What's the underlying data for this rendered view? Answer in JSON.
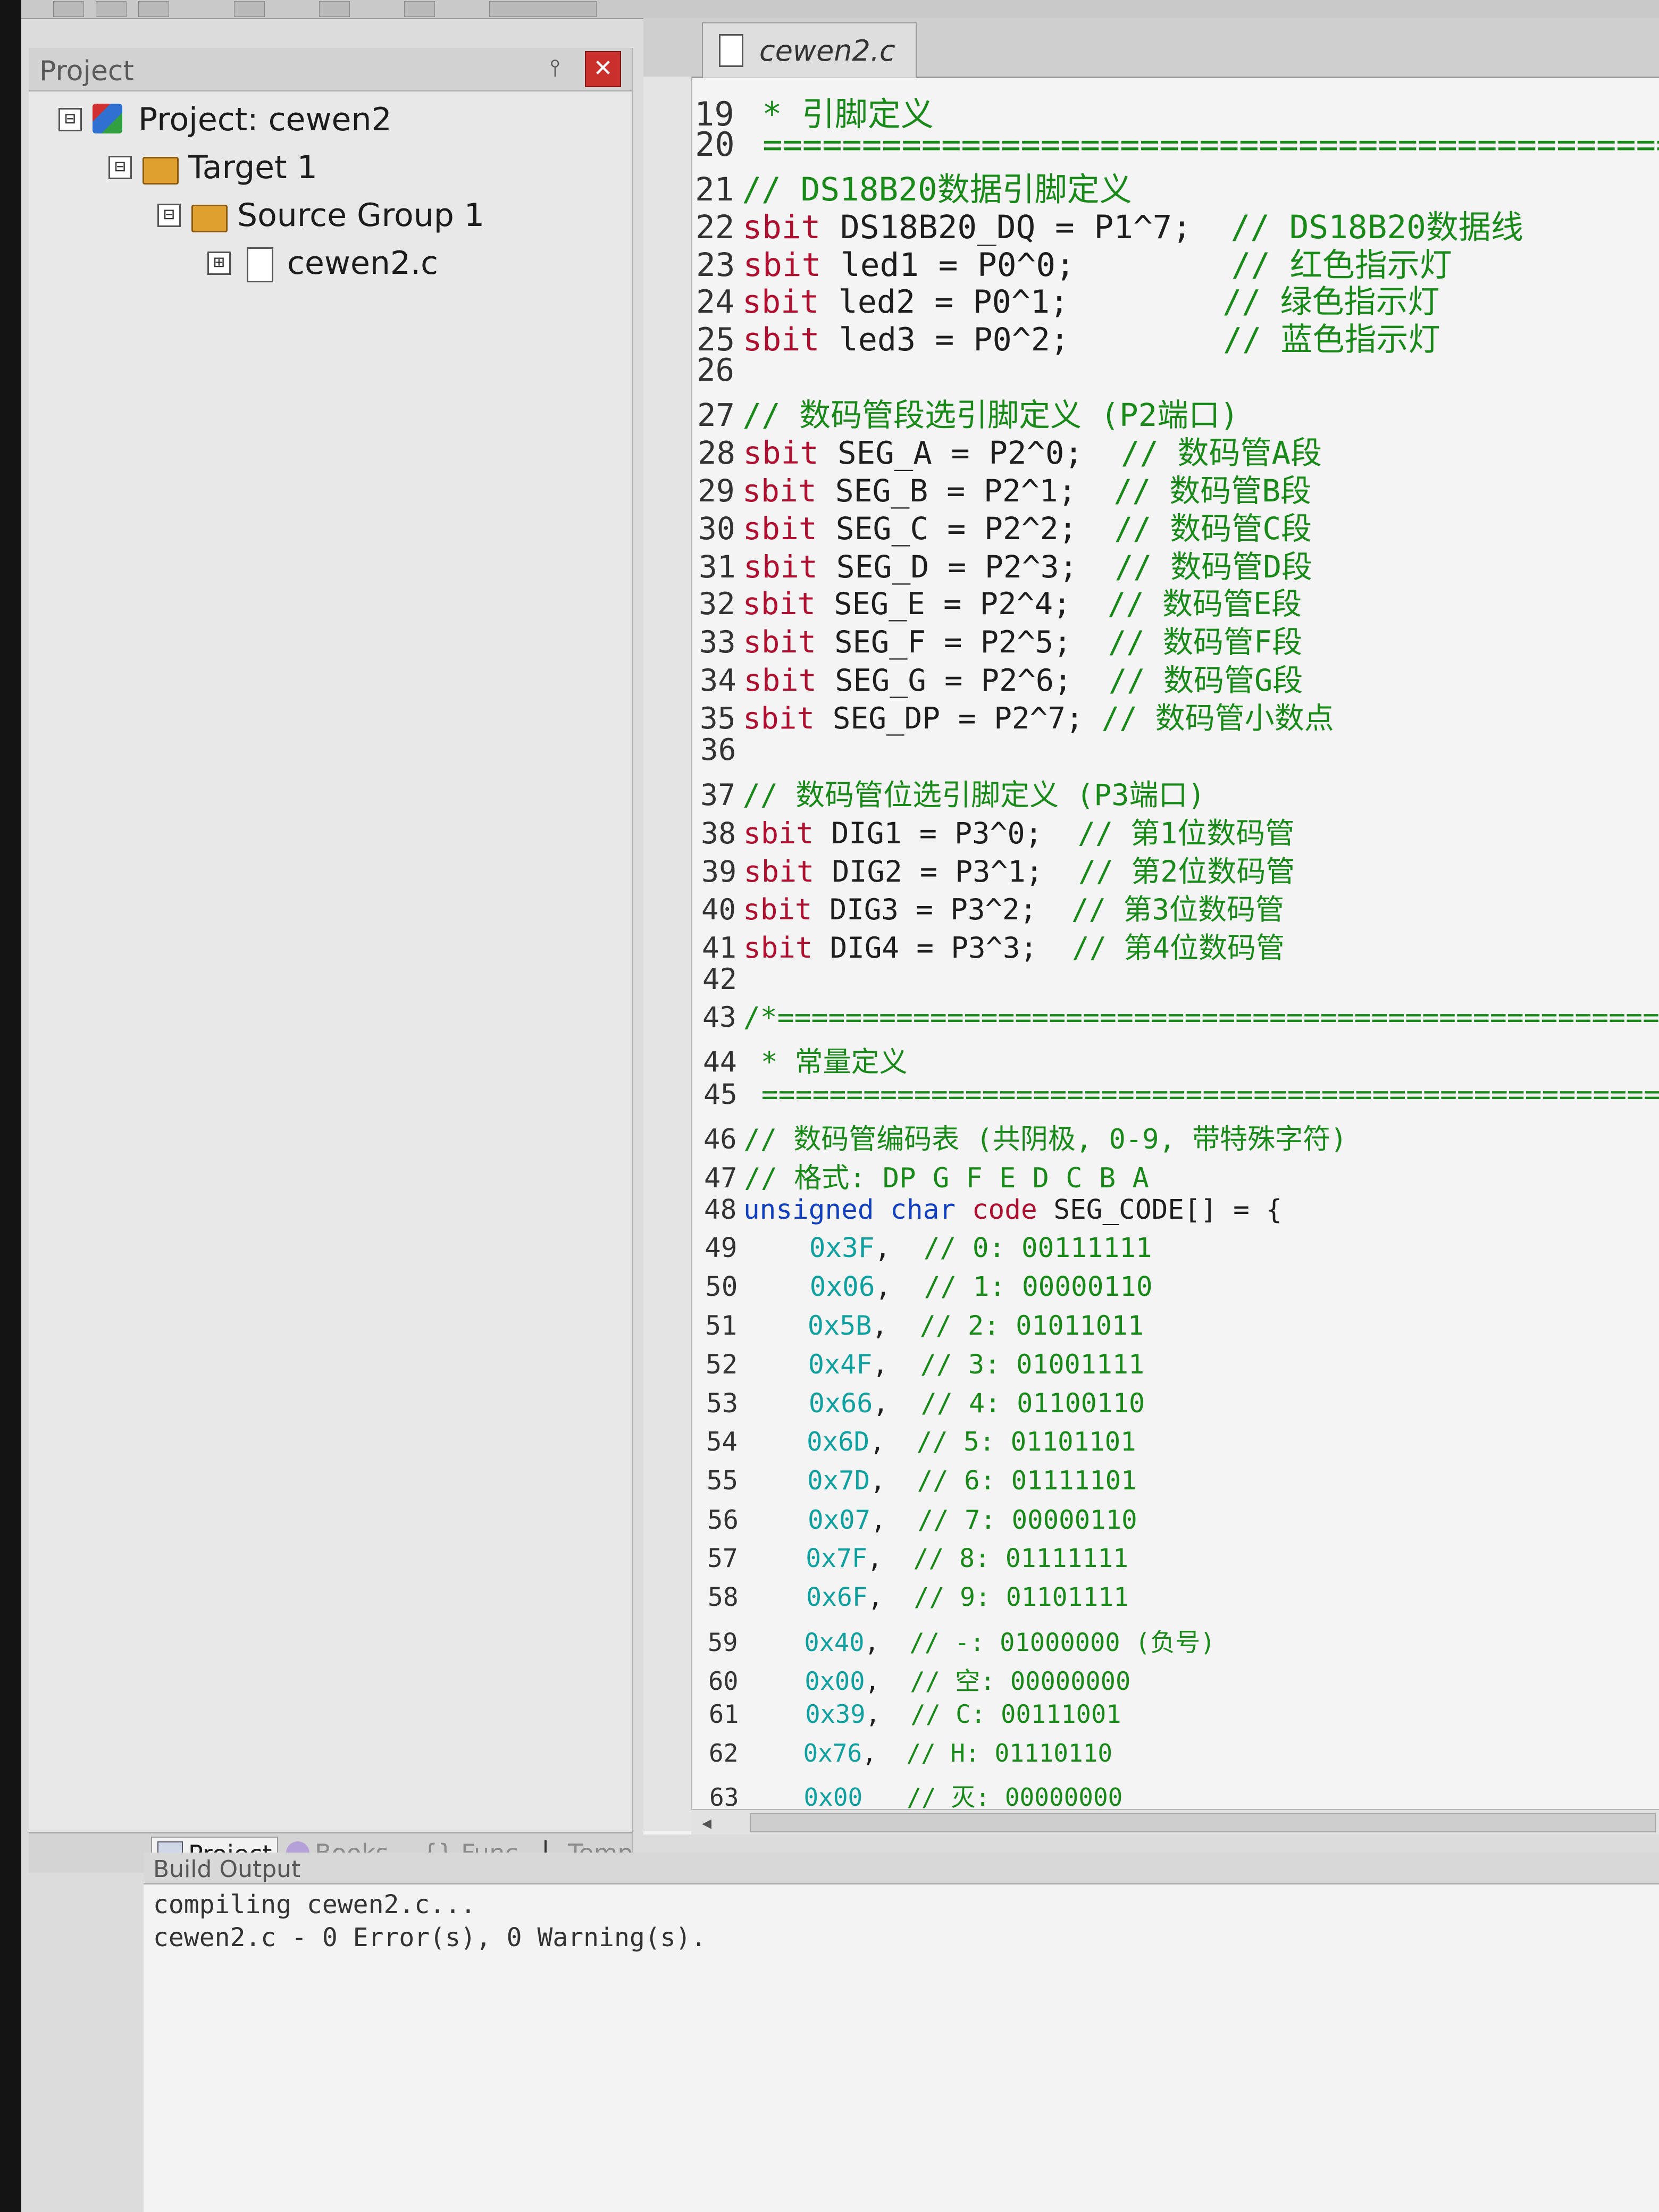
{
  "project_pane": {
    "title": "Project",
    "tree": [
      {
        "label": "Project: cewen2",
        "icon": "project-icon",
        "expander": "⊟",
        "depth": 0
      },
      {
        "label": "Target 1",
        "icon": "target-folder-icon",
        "expander": "⊟",
        "depth": 1
      },
      {
        "label": "Source Group 1",
        "icon": "folder-icon",
        "expander": "⊟",
        "depth": 2
      },
      {
        "label": "cewen2.c",
        "icon": "c-file-icon",
        "expander": "⊞",
        "depth": 3
      }
    ],
    "tabs": [
      "Project",
      "Books",
      "{} Func...",
      "Temp..."
    ]
  },
  "editor": {
    "tab_label": "cewen2.c",
    "lines": [
      {
        "n": "19",
        "segs": [
          [
            "cm",
            " * 引脚定义"
          ]
        ]
      },
      {
        "n": "20",
        "segs": [
          [
            "cm",
            " ================================================================"
          ]
        ]
      },
      {
        "n": "21",
        "segs": [
          [
            "cm",
            "// DS18B20数据引脚定义"
          ]
        ]
      },
      {
        "n": "22",
        "segs": [
          [
            "kw",
            "sbit"
          ],
          [
            "",
            " DS18B20_DQ = P1^7;  "
          ],
          [
            "cm",
            "// DS18B20数据线"
          ]
        ]
      },
      {
        "n": "23",
        "segs": [
          [
            "kw",
            "sbit"
          ],
          [
            "",
            " led1 = P0^0;        "
          ],
          [
            "cm",
            "// 红色指示灯"
          ]
        ]
      },
      {
        "n": "24",
        "segs": [
          [
            "kw",
            "sbit"
          ],
          [
            "",
            " led2 = P0^1;        "
          ],
          [
            "cm",
            "// 绿色指示灯"
          ]
        ]
      },
      {
        "n": "25",
        "segs": [
          [
            "kw",
            "sbit"
          ],
          [
            "",
            " led3 = P0^2;        "
          ],
          [
            "cm",
            "// 蓝色指示灯"
          ]
        ]
      },
      {
        "n": "26",
        "segs": []
      },
      {
        "n": "27",
        "segs": [
          [
            "cm",
            "// 数码管段选引脚定义 (P2端口)"
          ]
        ]
      },
      {
        "n": "28",
        "segs": [
          [
            "kw",
            "sbit"
          ],
          [
            "",
            " SEG_A = P2^0;  "
          ],
          [
            "cm",
            "// 数码管A段"
          ]
        ]
      },
      {
        "n": "29",
        "segs": [
          [
            "kw",
            "sbit"
          ],
          [
            "",
            " SEG_B = P2^1;  "
          ],
          [
            "cm",
            "// 数码管B段"
          ]
        ]
      },
      {
        "n": "30",
        "segs": [
          [
            "kw",
            "sbit"
          ],
          [
            "",
            " SEG_C = P2^2;  "
          ],
          [
            "cm",
            "// 数码管C段"
          ]
        ]
      },
      {
        "n": "31",
        "segs": [
          [
            "kw",
            "sbit"
          ],
          [
            "",
            " SEG_D = P2^3;  "
          ],
          [
            "cm",
            "// 数码管D段"
          ]
        ]
      },
      {
        "n": "32",
        "segs": [
          [
            "kw",
            "sbit"
          ],
          [
            "",
            " SEG_E = P2^4;  "
          ],
          [
            "cm",
            "// 数码管E段"
          ]
        ]
      },
      {
        "n": "33",
        "segs": [
          [
            "kw",
            "sbit"
          ],
          [
            "",
            " SEG_F = P2^5;  "
          ],
          [
            "cm",
            "// 数码管F段"
          ]
        ]
      },
      {
        "n": "34",
        "segs": [
          [
            "kw",
            "sbit"
          ],
          [
            "",
            " SEG_G = P2^6;  "
          ],
          [
            "cm",
            "// 数码管G段"
          ]
        ]
      },
      {
        "n": "35",
        "segs": [
          [
            "kw",
            "sbit"
          ],
          [
            "",
            " SEG_DP = P2^7; "
          ],
          [
            "cm",
            "// 数码管小数点"
          ]
        ]
      },
      {
        "n": "36",
        "segs": []
      },
      {
        "n": "37",
        "segs": [
          [
            "cm",
            "// 数码管位选引脚定义 (P3端口)"
          ]
        ]
      },
      {
        "n": "38",
        "segs": [
          [
            "kw",
            "sbit"
          ],
          [
            "",
            " DIG1 = P3^0;  "
          ],
          [
            "cm",
            "// 第1位数码管"
          ]
        ]
      },
      {
        "n": "39",
        "segs": [
          [
            "kw",
            "sbit"
          ],
          [
            "",
            " DIG2 = P3^1;  "
          ],
          [
            "cm",
            "// 第2位数码管"
          ]
        ]
      },
      {
        "n": "40",
        "segs": [
          [
            "kw",
            "sbit"
          ],
          [
            "",
            " DIG3 = P3^2;  "
          ],
          [
            "cm",
            "// 第3位数码管"
          ]
        ]
      },
      {
        "n": "41",
        "segs": [
          [
            "kw",
            "sbit"
          ],
          [
            "",
            " DIG4 = P3^3;  "
          ],
          [
            "cm",
            "// 第4位数码管"
          ]
        ]
      },
      {
        "n": "42",
        "segs": []
      },
      {
        "n": "43",
        "segs": [
          [
            "cm",
            "/*================================================================"
          ]
        ]
      },
      {
        "n": "44",
        "segs": [
          [
            "cm",
            " * 常量定义"
          ]
        ]
      },
      {
        "n": "45",
        "segs": [
          [
            "cm",
            " ================================================================"
          ]
        ]
      },
      {
        "n": "46",
        "segs": [
          [
            "cm",
            "// 数码管编码表 (共阴极, 0-9, 带特殊字符)"
          ]
        ]
      },
      {
        "n": "47",
        "segs": [
          [
            "cm",
            "// 格式: DP G F E D C B A"
          ]
        ]
      },
      {
        "n": "48",
        "segs": [
          [
            "ty",
            "unsigned char"
          ],
          [
            "",
            " "
          ],
          [
            "kw",
            "code"
          ],
          [
            "",
            " SEG_CODE[] = {"
          ]
        ]
      },
      {
        "n": "49",
        "segs": [
          [
            "",
            "    "
          ],
          [
            "nm",
            "0x3F"
          ],
          [
            "",
            ",  "
          ],
          [
            "cm",
            "// 0: 00111111"
          ]
        ]
      },
      {
        "n": "50",
        "segs": [
          [
            "",
            "    "
          ],
          [
            "nm",
            "0x06"
          ],
          [
            "",
            ",  "
          ],
          [
            "cm",
            "// 1: 00000110"
          ]
        ]
      },
      {
        "n": "51",
        "segs": [
          [
            "",
            "    "
          ],
          [
            "nm",
            "0x5B"
          ],
          [
            "",
            ",  "
          ],
          [
            "cm",
            "// 2: 01011011"
          ]
        ]
      },
      {
        "n": "52",
        "segs": [
          [
            "",
            "    "
          ],
          [
            "nm",
            "0x4F"
          ],
          [
            "",
            ",  "
          ],
          [
            "cm",
            "// 3: 01001111"
          ]
        ]
      },
      {
        "n": "53",
        "segs": [
          [
            "",
            "    "
          ],
          [
            "nm",
            "0x66"
          ],
          [
            "",
            ",  "
          ],
          [
            "cm",
            "// 4: 01100110"
          ]
        ]
      },
      {
        "n": "54",
        "segs": [
          [
            "",
            "    "
          ],
          [
            "nm",
            "0x6D"
          ],
          [
            "",
            ",  "
          ],
          [
            "cm",
            "// 5: 01101101"
          ]
        ]
      },
      {
        "n": "55",
        "segs": [
          [
            "",
            "    "
          ],
          [
            "nm",
            "0x7D"
          ],
          [
            "",
            ",  "
          ],
          [
            "cm",
            "// 6: 01111101"
          ]
        ]
      },
      {
        "n": "56",
        "segs": [
          [
            "",
            "    "
          ],
          [
            "nm",
            "0x07"
          ],
          [
            "",
            ",  "
          ],
          [
            "cm",
            "// 7: 00000110"
          ]
        ]
      },
      {
        "n": "57",
        "segs": [
          [
            "",
            "    "
          ],
          [
            "nm",
            "0x7F"
          ],
          [
            "",
            ",  "
          ],
          [
            "cm",
            "// 8: 01111111"
          ]
        ]
      },
      {
        "n": "58",
        "segs": [
          [
            "",
            "    "
          ],
          [
            "nm",
            "0x6F"
          ],
          [
            "",
            ",  "
          ],
          [
            "cm",
            "// 9: 01101111"
          ]
        ]
      },
      {
        "n": "59",
        "segs": [
          [
            "",
            "    "
          ],
          [
            "nm",
            "0x40"
          ],
          [
            "",
            ",  "
          ],
          [
            "cm",
            "// -: 01000000 (负号)"
          ]
        ]
      },
      {
        "n": "60",
        "segs": [
          [
            "",
            "    "
          ],
          [
            "nm",
            "0x00"
          ],
          [
            "",
            ",  "
          ],
          [
            "cm",
            "// 空: 00000000"
          ]
        ]
      },
      {
        "n": "61",
        "segs": [
          [
            "",
            "    "
          ],
          [
            "nm",
            "0x39"
          ],
          [
            "",
            ",  "
          ],
          [
            "cm",
            "// C: 00111001"
          ]
        ]
      },
      {
        "n": "62",
        "segs": [
          [
            "",
            "    "
          ],
          [
            "nm",
            "0x76"
          ],
          [
            "",
            ",  "
          ],
          [
            "cm",
            "// H: 01110110"
          ]
        ]
      },
      {
        "n": "63",
        "segs": [
          [
            "",
            "    "
          ],
          [
            "nm",
            "0x00"
          ],
          [
            "",
            "   "
          ],
          [
            "cm",
            "// 灭: 00000000"
          ]
        ]
      }
    ]
  },
  "build_output": {
    "title": "Build Output",
    "lines": [
      "compiling cewen2.c...",
      "cewen2.c - 0 Error(s), 0 Warning(s)."
    ]
  },
  "colors": {
    "keyword": "#b01030",
    "type": "#1040c0",
    "comment": "#198a19",
    "number": "#10a0a0"
  }
}
